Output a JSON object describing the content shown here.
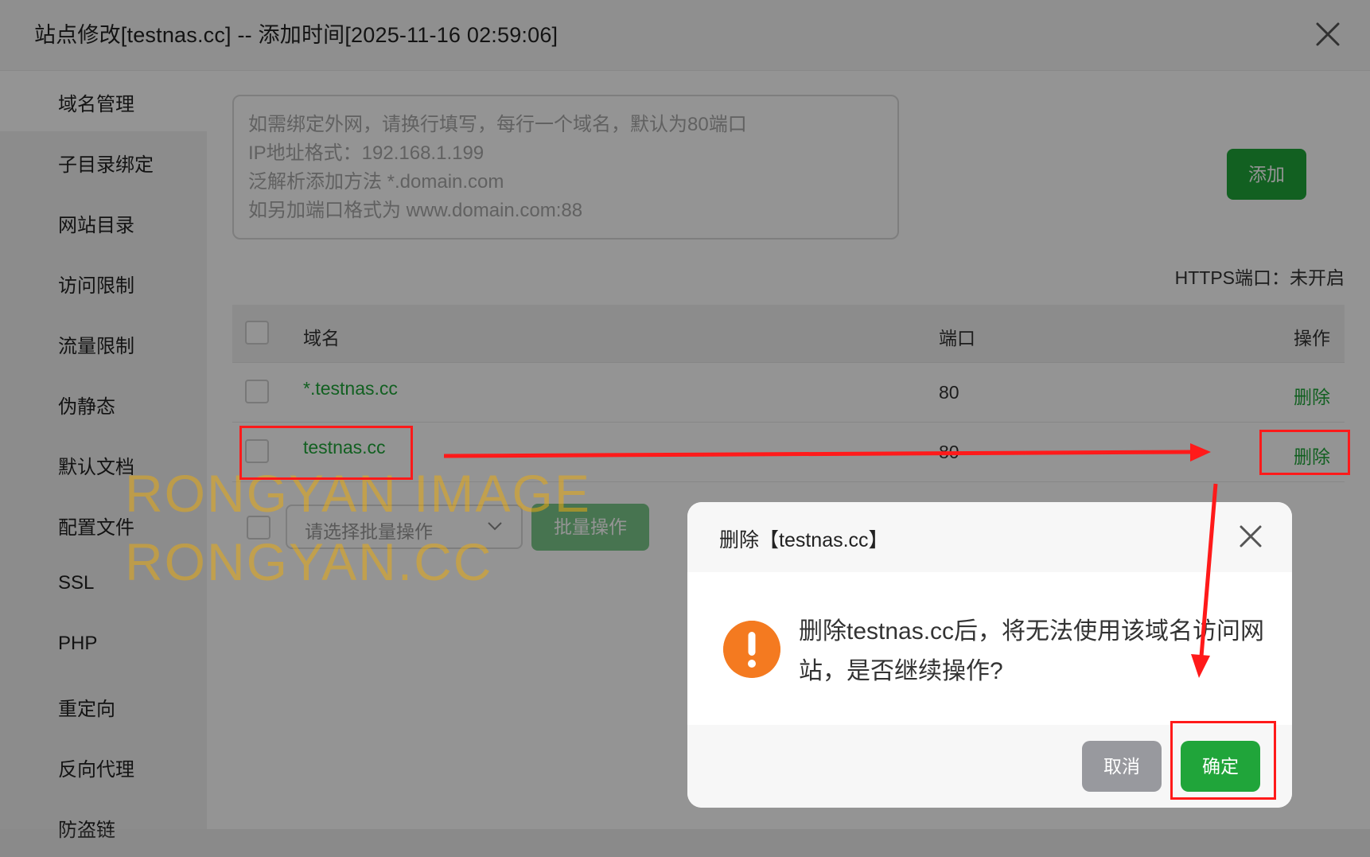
{
  "window": {
    "title": "站点修改[testnas.cc] -- 添加时间[2025-11-16 02:59:06]"
  },
  "sidebar": {
    "items": [
      {
        "label": "域名管理"
      },
      {
        "label": "子目录绑定"
      },
      {
        "label": "网站目录"
      },
      {
        "label": "访问限制"
      },
      {
        "label": "流量限制"
      },
      {
        "label": "伪静态"
      },
      {
        "label": "默认文档"
      },
      {
        "label": "配置文件"
      },
      {
        "label": "SSL"
      },
      {
        "label": "PHP"
      },
      {
        "label": "重定向"
      },
      {
        "label": "反向代理"
      },
      {
        "label": "防盗链"
      }
    ]
  },
  "domain_input": {
    "placeholder_lines": [
      "如需绑定外网，请换行填写，每行一个域名，默认为80端口",
      "IP地址格式：192.168.1.199",
      "泛解析添加方法 *.domain.com",
      "如另加端口格式为 www.domain.com:88"
    ]
  },
  "add_button": "添加",
  "https_status": "HTTPS端口：未开启",
  "table": {
    "columns": [
      "域名",
      "端口",
      "操作"
    ],
    "rows": [
      {
        "domain": "*.testnas.cc",
        "port": "80",
        "action": "删除"
      },
      {
        "domain": "testnas.cc",
        "port": "80",
        "action": "删除"
      }
    ]
  },
  "batch": {
    "select_placeholder": "请选择批量操作",
    "button": "批量操作"
  },
  "watermark": {
    "line1": "RONGYAN IMAGE",
    "line2": "RONGYAN.CC"
  },
  "dialog": {
    "title": "删除【testnas.cc】",
    "message": "删除testnas.cc后，将无法使用该域名访问网站，是否继续操作?",
    "cancel": "取消",
    "confirm": "确定",
    "icon": "warning-icon"
  },
  "colors": {
    "accent": "#20a53a",
    "warning": "#f47a20",
    "annotation": "#ff1a1a"
  }
}
